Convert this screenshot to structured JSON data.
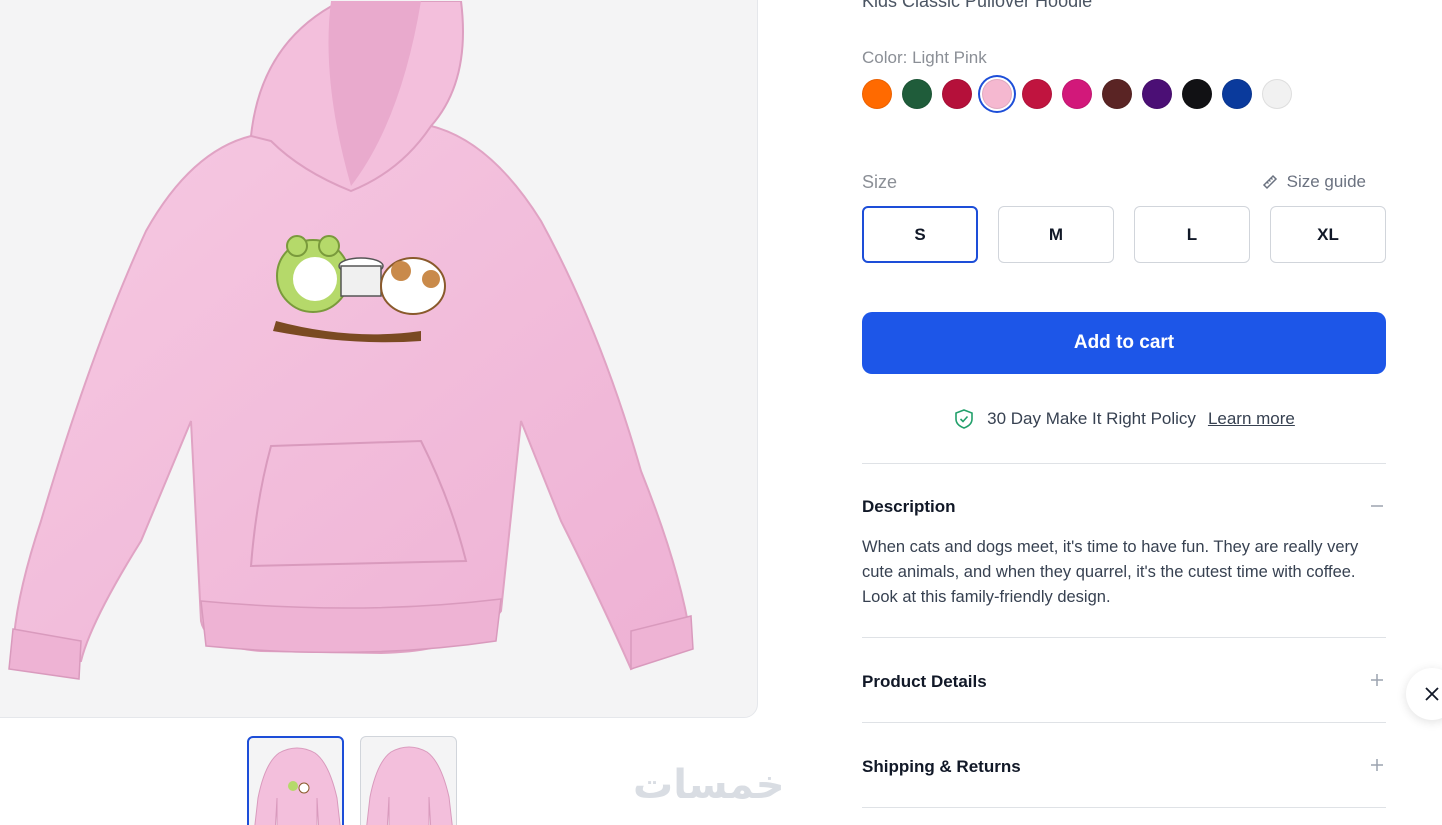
{
  "product": {
    "title": "Kids Classic Pullover Hoodie",
    "color_label": "Color: Light Pink",
    "colors": [
      "#ff6a00",
      "#1f5c3a",
      "#b5103a",
      "#f5b8d0",
      "#c0143f",
      "#d2187a",
      "#5a2424",
      "#4b0f75",
      "#111114",
      "#0a3a9c",
      "#f1f1f1"
    ],
    "selected_color_index": 3
  },
  "size": {
    "label": "Size",
    "guide_label": "Size guide",
    "options": [
      "S",
      "M",
      "L",
      "XL"
    ],
    "selected": "S"
  },
  "cart": {
    "add_label": "Add to cart"
  },
  "policy": {
    "text": "30 Day Make It Right Policy",
    "link": "Learn more"
  },
  "accordion": {
    "description": {
      "title": "Description",
      "text": "When cats and dogs meet, it's time to have fun. They are really very cute animals, and when they quarrel, it's the cutest time with coffee. Look at this family-friendly design."
    },
    "details": {
      "title": "Product Details"
    },
    "shipping": {
      "title": "Shipping & Returns"
    }
  },
  "watermark": "خمسات",
  "colors": {
    "accent": "#1d56e8",
    "hoodie": "#f3bfdc"
  }
}
